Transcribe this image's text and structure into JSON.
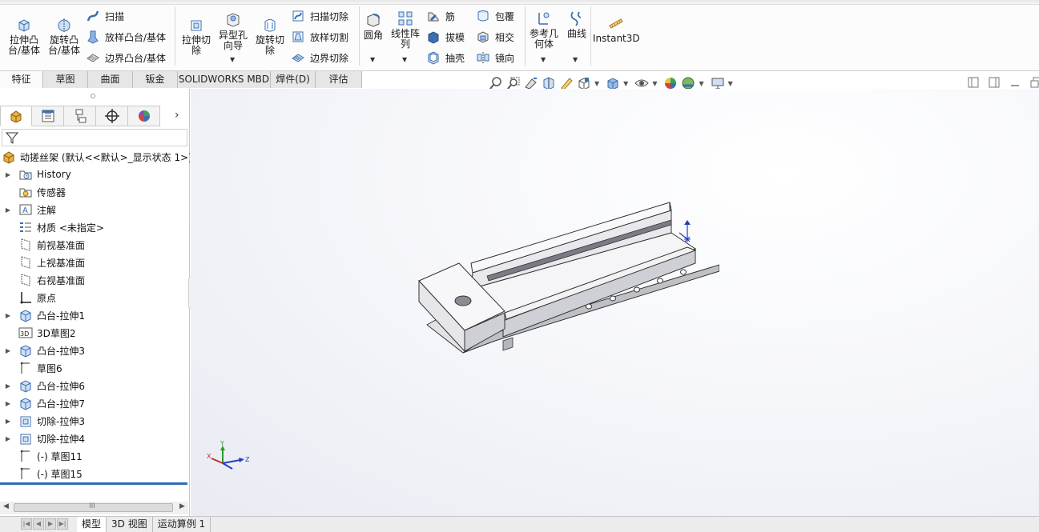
{
  "ribbon": {
    "extrude_boss": "拉伸凸\n台/基体",
    "revolve_boss": "旋转凸\n台/基体",
    "sweep": "扫描",
    "loft_boss": "放样凸台/基体",
    "boundary_boss": "边界凸台/基体",
    "extrude_cut": "拉伸切\n除",
    "hole_wizard": "异型孔\n向导",
    "revolve_cut": "旋转切\n除",
    "sweep_cut": "扫描切除",
    "loft_cut": "放样切割",
    "boundary_cut": "边界切除",
    "fillet": "圆角",
    "linear_pattern": "线性阵\n列",
    "rib": "筋",
    "draft": "拔模",
    "shell": "抽壳",
    "wrap": "包覆",
    "intersect": "相交",
    "mirror": "镜向",
    "ref_geometry": "参考几\n何体",
    "curves": "曲线",
    "instant3d": "Instant3D"
  },
  "tabs": [
    "特征",
    "草图",
    "曲面",
    "钣金",
    "SOLIDWORKS MBD",
    "焊件(D)",
    "评估"
  ],
  "tree": {
    "root": "动搓丝架 (默认<<默认>_显示状态 1>)",
    "items": [
      {
        "label": "History",
        "icon": "history-folder-icon",
        "expand": true
      },
      {
        "label": "传感器",
        "icon": "sensor-icon",
        "expand": false
      },
      {
        "label": "注解",
        "icon": "annotation-icon",
        "expand": true
      },
      {
        "label": "材质 <未指定>",
        "icon": "material-icon",
        "expand": false
      },
      {
        "label": "前视基准面",
        "icon": "plane-icon",
        "expand": false
      },
      {
        "label": "上视基准面",
        "icon": "plane-icon",
        "expand": false
      },
      {
        "label": "右视基准面",
        "icon": "plane-icon",
        "expand": false
      },
      {
        "label": "原点",
        "icon": "origin-icon",
        "expand": false
      },
      {
        "label": "凸台-拉伸1",
        "icon": "boss-extrude-icon",
        "expand": true
      },
      {
        "label": "3D草图2",
        "icon": "sketch3d-icon",
        "expand": false
      },
      {
        "label": "凸台-拉伸3",
        "icon": "boss-extrude-icon",
        "expand": true
      },
      {
        "label": "草图6",
        "icon": "sketch-icon",
        "expand": false
      },
      {
        "label": "凸台-拉伸6",
        "icon": "boss-extrude-icon",
        "expand": true
      },
      {
        "label": "凸台-拉伸7",
        "icon": "boss-extrude-icon",
        "expand": true
      },
      {
        "label": "切除-拉伸3",
        "icon": "cut-extrude-icon",
        "expand": true
      },
      {
        "label": "切除-拉伸4",
        "icon": "cut-extrude-icon",
        "expand": true
      },
      {
        "label": "(-) 草图11",
        "icon": "sketch-icon",
        "expand": false
      },
      {
        "label": "(-) 草图15",
        "icon": "sketch-icon",
        "expand": false
      }
    ]
  },
  "bottom_tabs": [
    "模型",
    "3D 视图",
    "运动算例 1"
  ],
  "scroll_glyph": "III",
  "triad": {
    "x": "X",
    "y": "Y",
    "z": "Z"
  },
  "colors": {
    "accent": "#2f6db5",
    "icon_blue": "#3a6fb0",
    "model_face": "#f4f4f6",
    "model_edge": "#333333"
  }
}
